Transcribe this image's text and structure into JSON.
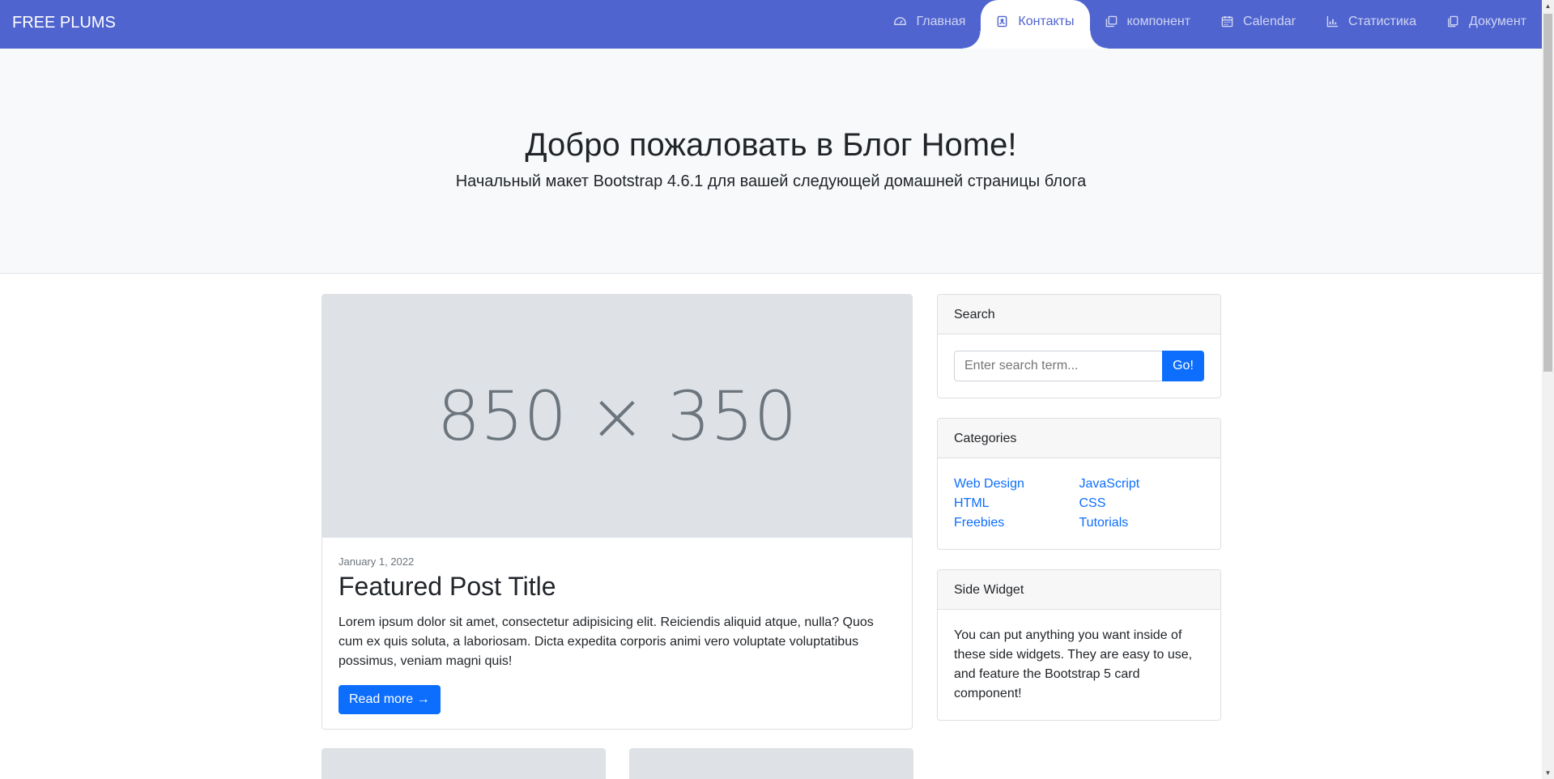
{
  "brand": "FREE PLUMS",
  "nav": [
    {
      "label": "Главная",
      "icon": "dashboard-icon"
    },
    {
      "label": "Контакты",
      "icon": "contact-card-icon",
      "active": true
    },
    {
      "label": "компонент",
      "icon": "copy-icon"
    },
    {
      "label": "Calendar",
      "icon": "calendar-icon"
    },
    {
      "label": "Статистика",
      "icon": "bar-chart-icon"
    },
    {
      "label": "Документ",
      "icon": "document-icon"
    }
  ],
  "hero": {
    "title": "Добро пожаловать в Блог Home!",
    "subtitle": "Начальный макет Bootstrap 4.6.1 для вашей следующей домашней страницы блога"
  },
  "featured": {
    "image_text": "850 × 350",
    "date": "January 1, 2022",
    "title": "Featured Post Title",
    "text": "Lorem ipsum dolor sit amet, consectetur adipisicing elit. Reiciendis aliquid atque, nulla? Quos cum ex quis soluta, a laboriosam. Dicta expedita corporis animi vero voluptate voluptatibus possimus, veniam magni quis!",
    "button": "Read more →"
  },
  "search": {
    "header": "Search",
    "placeholder": "Enter search term...",
    "button": "Go!"
  },
  "categories": {
    "header": "Categories",
    "left": [
      "Web Design",
      "HTML",
      "Freebies"
    ],
    "right": [
      "JavaScript",
      "CSS",
      "Tutorials"
    ]
  },
  "side_widget": {
    "header": "Side Widget",
    "text": "You can put anything you want inside of these side widgets. They are easy to use, and feature the Bootstrap 5 card component!"
  },
  "colors": {
    "navbar": "#5064cf",
    "primary": "#0d6efd",
    "hero_bg": "#f8f9fa"
  }
}
